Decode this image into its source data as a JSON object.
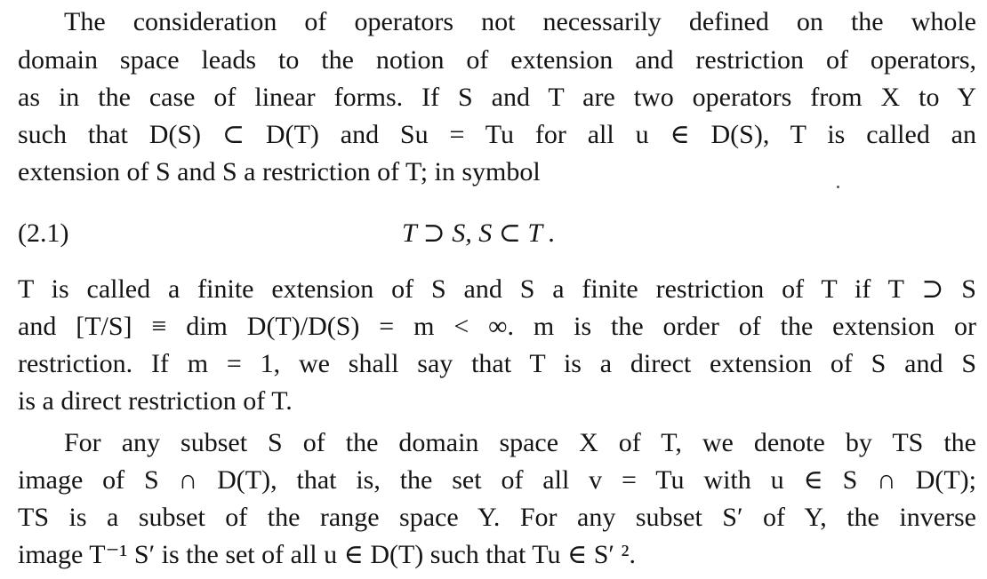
{
  "paragraphs": {
    "p1": {
      "lines": [
        "The consideration of operators not necessarily defined on the whole",
        "domain space leads to the notion of extension and restriction of operators,",
        "as in the case of linear forms. If S and T are two operators from X to Y",
        "such that D(S) ⊂ D(T) and Su = Tu for all u ∈ D(S), T is called an",
        "extension of S and S a restriction of T; in symbol"
      ]
    },
    "equation": {
      "number": "(2.1)",
      "formula": "T ⊃ S,   S ⊂ T ."
    },
    "p2": {
      "lines": [
        "T is called a finite extension of S and S a finite restriction of T if T ⊃ S",
        "and [T/S] ≡ dim D(T)/D(S) = m < ∞. m is the order of the extension or",
        "restriction. If m = 1, we shall say that T is a direct extension of S and S",
        "is a direct restriction of T."
      ]
    },
    "p3": {
      "lines": [
        "For any subset S of the domain space X of T, we denote by TS the",
        "image of S ∩ D(T), that is, the set of all v = Tu with u ∈ S ∩ D(T);",
        "TS is a subset of the range space Y. For any subset S′ of Y, the inverse",
        "image T⁻¹ S′ is the set of all u ∈ D(T) such that Tu ∈ S′ ²."
      ]
    }
  }
}
